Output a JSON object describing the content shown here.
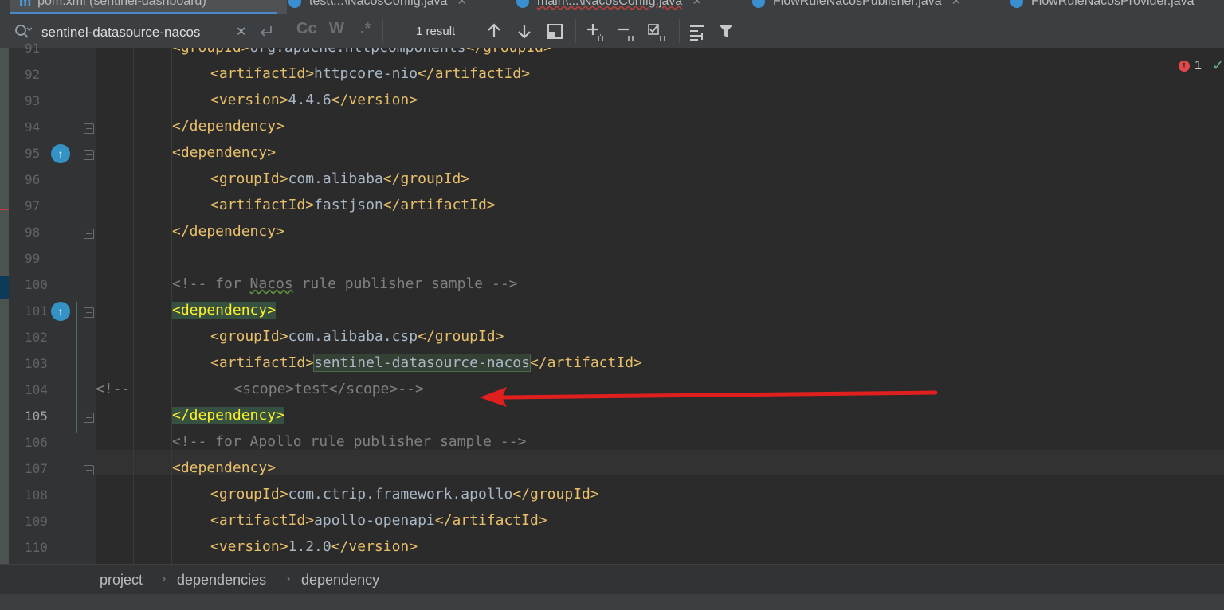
{
  "tabs": [
    {
      "label": "pom.xml (sentinel-dashboard)",
      "icon": "maven-icon",
      "active": true
    },
    {
      "label": "test\\...\\NacosConfig.java",
      "icon": "java-class-icon"
    },
    {
      "label": "main\\...\\NacosConfig.java",
      "icon": "java-class-icon"
    },
    {
      "label": "FlowRuleNacosPublisher.java",
      "icon": "java-class-icon"
    },
    {
      "label": "FlowRuleNacosProvider.java",
      "icon": "java-class-icon"
    }
  ],
  "search": {
    "query": "sentinel-datasource-nacos",
    "result_count": "1 result",
    "case_label": "Cc",
    "words_label": "W",
    "regex_label": ".*"
  },
  "editor": {
    "lines": [
      {
        "n": "91",
        "indent": 8,
        "parts": [
          [
            "tag",
            "<groupId>"
          ],
          [
            "txt",
            "org.apache.httpcomponents"
          ],
          [
            "tag",
            "</groupId>"
          ]
        ]
      },
      {
        "n": "92",
        "indent": 12,
        "parts": [
          [
            "tag",
            "<artifactId>"
          ],
          [
            "txt",
            "httpcore-nio"
          ],
          [
            "tag",
            "</artifactId>"
          ]
        ]
      },
      {
        "n": "93",
        "indent": 12,
        "parts": [
          [
            "tag",
            "<version>"
          ],
          [
            "txt",
            "4.4.6"
          ],
          [
            "tag",
            "</version>"
          ]
        ]
      },
      {
        "n": "94",
        "indent": 8,
        "parts": [
          [
            "tag",
            "</dependency>"
          ]
        ]
      },
      {
        "n": "95",
        "indent": 8,
        "parts": [
          [
            "tag",
            "<dependency>"
          ]
        ]
      },
      {
        "n": "96",
        "indent": 12,
        "parts": [
          [
            "tag",
            "<groupId>"
          ],
          [
            "txt",
            "com.alibaba"
          ],
          [
            "tag",
            "</groupId>"
          ]
        ]
      },
      {
        "n": "97",
        "indent": 12,
        "parts": [
          [
            "tag",
            "<artifactId>"
          ],
          [
            "txt",
            "fastjson"
          ],
          [
            "tag",
            "</artifactId>"
          ]
        ]
      },
      {
        "n": "98",
        "indent": 8,
        "parts": [
          [
            "tag",
            "</dependency>"
          ]
        ]
      },
      {
        "n": "99",
        "indent": 0,
        "parts": []
      },
      {
        "n": "100",
        "indent": 8,
        "parts": [
          [
            "cmt",
            "<!-- for "
          ],
          [
            "cmtw",
            "Nacos"
          ],
          [
            "cmt",
            " rule publisher sample -->"
          ]
        ]
      },
      {
        "n": "101",
        "indent": 8,
        "parts": [
          [
            "hltag",
            "<dependency>"
          ]
        ]
      },
      {
        "n": "102",
        "indent": 12,
        "parts": [
          [
            "tag",
            "<groupId>"
          ],
          [
            "txt",
            "com.alibaba.csp"
          ],
          [
            "tag",
            "</groupId>"
          ]
        ]
      },
      {
        "n": "103",
        "indent": 12,
        "parts": [
          [
            "tag",
            "<artifactId>"
          ],
          [
            "hlbox",
            "sentinel-datasource-nacos"
          ],
          [
            "tag",
            "</artifactId>"
          ]
        ]
      },
      {
        "n": "104",
        "indent": 0,
        "parts": [
          [
            "cmt",
            "<!--            <scope>test</scope>-->"
          ]
        ]
      },
      {
        "n": "105",
        "indent": 8,
        "parts": [
          [
            "hltag",
            "</dependency>"
          ]
        ]
      },
      {
        "n": "106",
        "indent": 8,
        "parts": [
          [
            "cmt",
            "<!-- for Apollo rule publisher sample -->"
          ]
        ]
      },
      {
        "n": "107",
        "indent": 8,
        "parts": [
          [
            "tag",
            "<dependency>"
          ]
        ]
      },
      {
        "n": "108",
        "indent": 12,
        "parts": [
          [
            "tag",
            "<groupId>"
          ],
          [
            "txt",
            "com.ctrip.framework.apollo"
          ],
          [
            "tag",
            "</groupId>"
          ]
        ]
      },
      {
        "n": "109",
        "indent": 12,
        "parts": [
          [
            "tag",
            "<artifactId>"
          ],
          [
            "txt",
            "apollo-openapi"
          ],
          [
            "tag",
            "</artifactId>"
          ]
        ]
      },
      {
        "n": "110",
        "indent": 12,
        "parts": [
          [
            "tag",
            "<version>"
          ],
          [
            "txt",
            "1.2.0"
          ],
          [
            "tag",
            "</version>"
          ]
        ]
      }
    ],
    "current_line": "105"
  },
  "inspections": {
    "error_count": "1"
  },
  "breadcrumbs": [
    "project",
    "dependencies",
    "dependency"
  ],
  "colors": {
    "tag": "#e8bf6a",
    "text": "#a9b7c6",
    "comment": "#808080",
    "match": "#36513f",
    "arrow": "#e0201f"
  }
}
